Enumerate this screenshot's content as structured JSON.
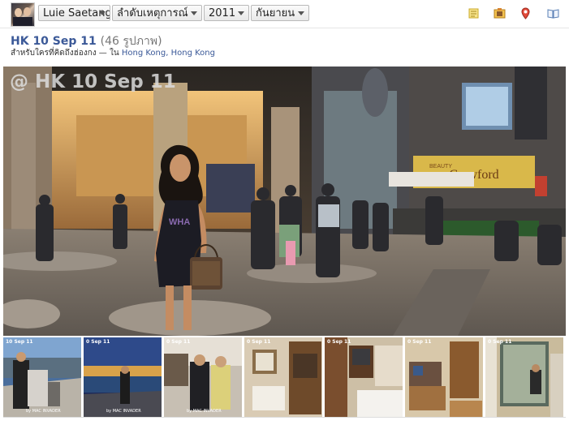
{
  "topbar": {
    "owner_name": "Luie Saetang",
    "sort_label": "ลำดับเหตุการณ์",
    "year": "2011",
    "month": "กันยายน",
    "icons": [
      "note-icon",
      "photo-album-icon",
      "map-pin-icon",
      "book-icon"
    ]
  },
  "album": {
    "title": "HK 10 Sep 11",
    "photo_count": "(46 รูปภาพ)",
    "audience_prefix": "สำหรับใครที่คิดถึงฮ่องกง — ใน ",
    "location": "Hong Kong, Hong Kong"
  },
  "main_photo": {
    "watermark": "@ HK 10 Sep 11",
    "shop_sign": "Crawford",
    "shop_sign_small": "BEAUTY"
  },
  "thumbnails": [
    {
      "caption": "10 Sep 11",
      "signature": "by MAC INVADER"
    },
    {
      "caption": "0 Sep 11",
      "signature": "by MAC INVADER"
    },
    {
      "caption": "0 Sep 11",
      "signature": "by MAC INVADER"
    },
    {
      "caption": "0 Sep 11",
      "signature": ""
    },
    {
      "caption": "0 Sep 11",
      "signature": ""
    },
    {
      "caption": "0 Sep 11",
      "signature": ""
    },
    {
      "caption": "0 Sep 11",
      "signature": ""
    }
  ],
  "colors": {
    "link_blue": "#3b5998",
    "watermark": "#dcdcdc"
  }
}
